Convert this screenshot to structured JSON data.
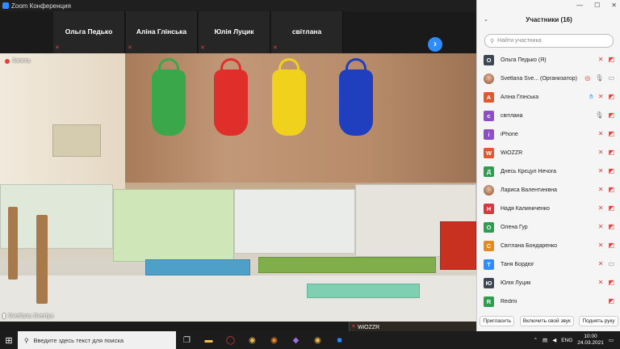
{
  "window": {
    "title": "Zoom Конференция"
  },
  "thumbnails": [
    {
      "name": "Ольга Педько"
    },
    {
      "name": "Аліна Глінська"
    },
    {
      "name": "Юлія Луцик"
    },
    {
      "name": "світлана"
    },
    {
      "name": "WiOZZR",
      "video": true
    }
  ],
  "main_video": {
    "recording_label": "Запись",
    "speaker": "Svetlana Sveriya"
  },
  "participants": {
    "title": "Участники (16)",
    "search_placeholder": "Найти участника",
    "items": [
      {
        "initial": "О",
        "color": "#3d4754",
        "name": "Ольга Педько (Я)",
        "icons": [
          "mic-muted-icon",
          "video-off-icon"
        ]
      },
      {
        "initial": "",
        "color": "",
        "photo": true,
        "name": "Svetlana Sve... (Организатор)",
        "icons": [
          "share-icon",
          "mic-icon",
          "video-icon"
        ]
      },
      {
        "initial": "А",
        "color": "#e2572b",
        "name": "Аліна Глінська",
        "icons": [
          "raised-hand-icon",
          "mic-muted-icon",
          "video-off-icon"
        ]
      },
      {
        "initial": "с",
        "color": "#8d4ec8",
        "name": "світлана",
        "icons": [
          "mic-icon",
          "video-off-icon"
        ]
      },
      {
        "initial": "i",
        "color": "#8d4ec8",
        "name": "iPhone",
        "icons": [
          "mic-muted-icon",
          "video-off-icon"
        ]
      },
      {
        "initial": "W",
        "color": "#e2572b",
        "name": "WiOZZR",
        "icons": [
          "mic-muted-icon",
          "video-off-icon"
        ]
      },
      {
        "initial": "Д",
        "color": "#2e9d4f",
        "name": "Днесь Крєцул Нечога",
        "icons": [
          "mic-muted-icon",
          "video-off-icon"
        ]
      },
      {
        "initial": "",
        "color": "",
        "photo": true,
        "name": "Лариса Валентинівна",
        "icons": [
          "mic-muted-icon",
          "video-off-icon"
        ]
      },
      {
        "initial": "Н",
        "color": "#d9363e",
        "name": "Надя Калиниченко",
        "icons": [
          "mic-muted-icon",
          "video-off-icon"
        ]
      },
      {
        "initial": "О",
        "color": "#2e9d4f",
        "name": "Олена Гур",
        "icons": [
          "mic-muted-icon",
          "video-off-icon"
        ]
      },
      {
        "initial": "С",
        "color": "#e58a1f",
        "name": "Світлана Бондаренко",
        "icons": [
          "mic-muted-icon",
          "video-off-icon"
        ]
      },
      {
        "initial": "Т",
        "color": "#2d8cff",
        "name": "Таня Бордюг",
        "icons": [
          "mic-muted-icon",
          "video-icon"
        ]
      },
      {
        "initial": "Ю",
        "color": "#3d4754",
        "name": "Юлія Луцик",
        "icons": [
          "mic-muted-icon",
          "video-off-icon"
        ]
      },
      {
        "initial": "R",
        "color": "#2e9d4f",
        "name": "Redmi",
        "icons": [
          "video-off-icon"
        ]
      }
    ],
    "buttons": {
      "invite": "Пригласить",
      "unmute": "Включить свой звук",
      "raise_hand": "Поднять руку"
    }
  },
  "taskbar": {
    "search_placeholder": "Введите здесь текст для поиска",
    "lang": "ENG",
    "time": "10:00",
    "date": "24.03.2021"
  }
}
